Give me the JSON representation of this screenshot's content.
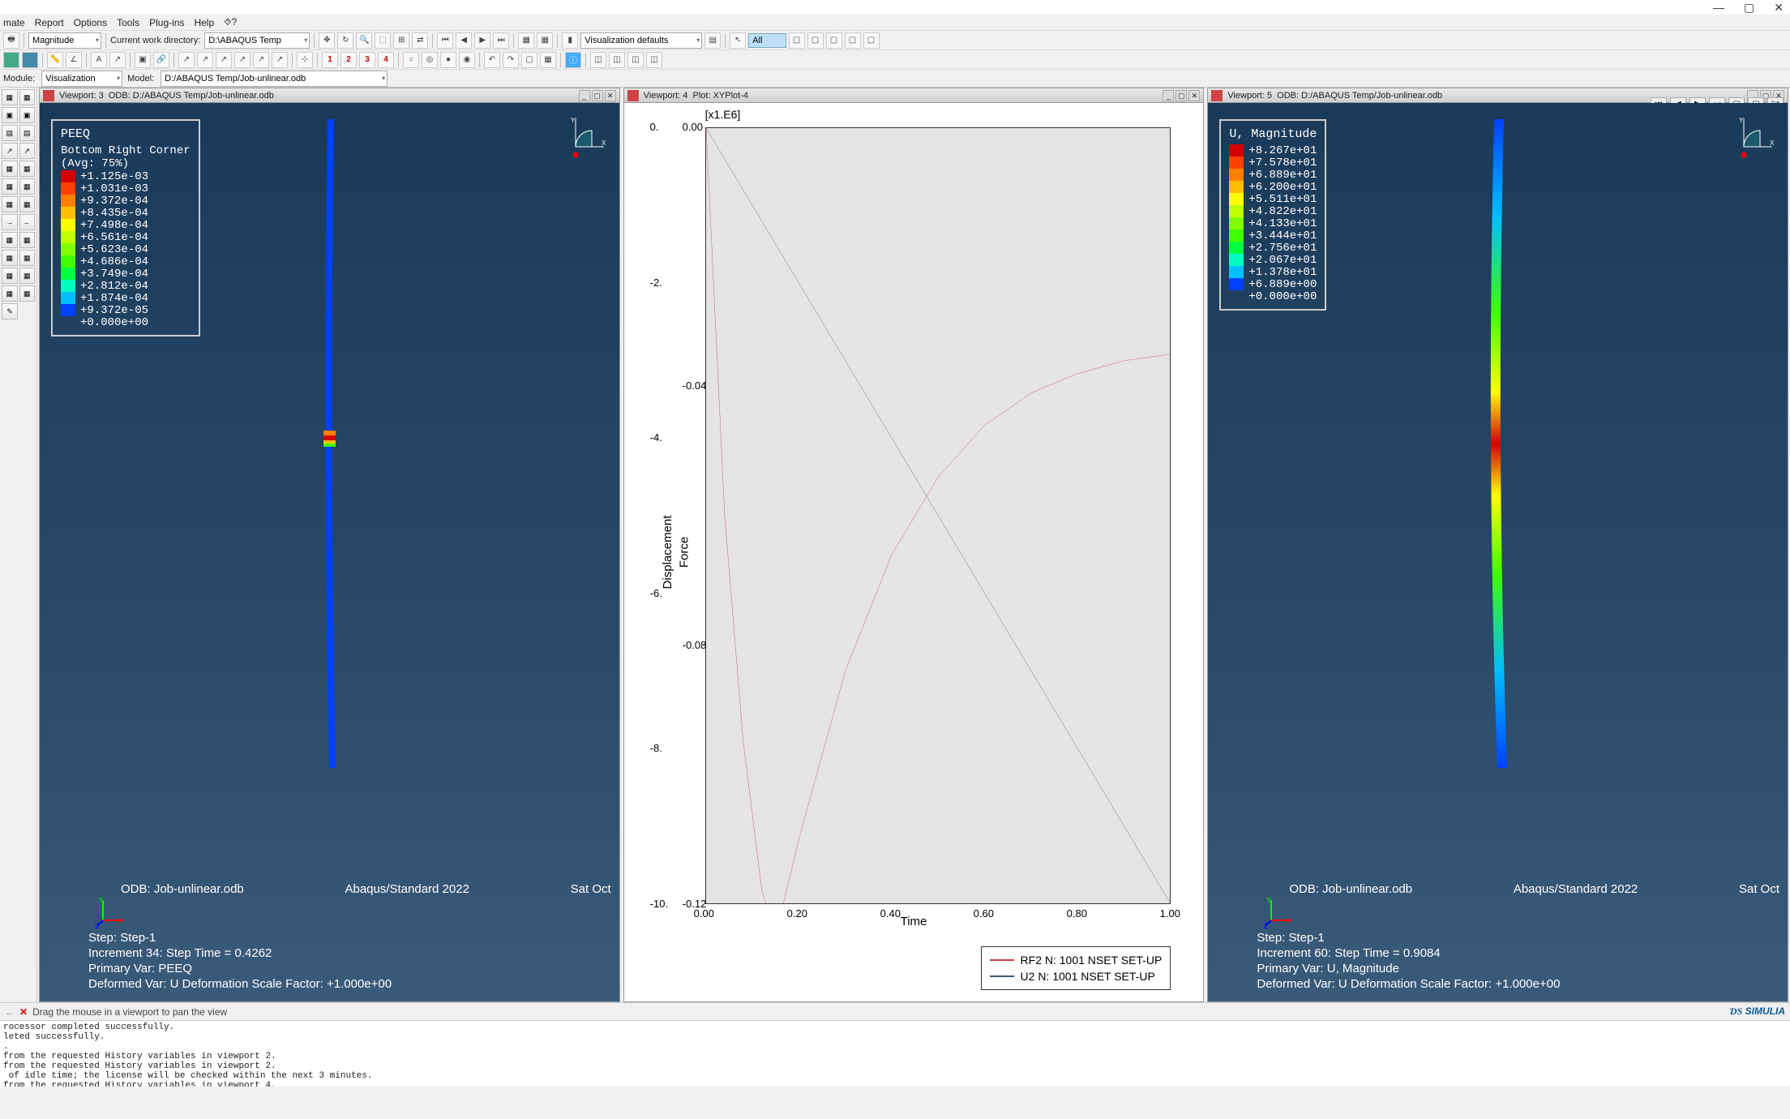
{
  "window": {
    "min": "—",
    "max": "▢",
    "close": "✕"
  },
  "menubar": [
    "mate",
    "Report",
    "Options",
    "Tools",
    "Plug-ins",
    "Help",
    "⯑?"
  ],
  "toolbar1": {
    "combo1": "Magnitude",
    "cwd_label": "Current work directory:",
    "cwd": "D:\\ABAQUS Temp",
    "vizdef": "Visualization defaults",
    "all": "All"
  },
  "toolbar2": {
    "nums": [
      "1",
      "2",
      "3",
      "4"
    ]
  },
  "toolbar3": {
    "module_lbl": "Module:",
    "module": "Visualization",
    "model_lbl": "Model:",
    "model": "D:/ABAQUS Temp/Job-unlinear.odb"
  },
  "playback": [
    "⏮",
    "◀",
    "▶",
    "⏭"
  ],
  "vp3": {
    "hdr_num": "Viewport: 3",
    "hdr_odb": "ODB: D:/ABAQUS Temp/Job-unlinear.odb",
    "legend": {
      "title": "PEEQ",
      "sub1": "Bottom Right Corner",
      "sub2": "(Avg: 75%)",
      "vals": [
        "+1.125e-03",
        "+1.031e-03",
        "+9.372e-04",
        "+8.435e-04",
        "+7.498e-04",
        "+6.561e-04",
        "+5.623e-04",
        "+4.686e-04",
        "+3.749e-04",
        "+2.812e-04",
        "+1.874e-04",
        "+9.372e-05",
        "+0.000e+00"
      ]
    },
    "odb": "ODB: Job-unlinear.odb",
    "brand": "Abaqus/Standard 2022",
    "date": "Sat Oct",
    "step": "Step: Step-1",
    "incr": "Increment     34: Step Time =    0.4262",
    "pvar": "Primary Var: PEEQ",
    "dvar": "Deformed Var: U   Deformation Scale Factor: +1.000e+00"
  },
  "vp4": {
    "hdr_num": "Viewport: 4",
    "hdr_plot": "Plot: XYPlot-4",
    "exponent": "[x1.E6]",
    "ylabel1": "Displacement",
    "ylabel2": "Force",
    "xlabel": "Time",
    "legend1": "RF2 N: 1001 NSET SET-UP",
    "legend2": "U2 N: 1001 NSET SET-UP"
  },
  "vp5": {
    "hdr_num": "Viewport: 5",
    "hdr_odb": "ODB: D:/ABAQUS Temp/Job-unlinear.odb",
    "legend": {
      "title": "U, Magnitude",
      "vals": [
        "+8.267e+01",
        "+7.578e+01",
        "+6.889e+01",
        "+6.200e+01",
        "+5.511e+01",
        "+4.822e+01",
        "+4.133e+01",
        "+3.444e+01",
        "+2.756e+01",
        "+2.067e+01",
        "+1.378e+01",
        "+6.889e+00",
        "+0.000e+00"
      ]
    },
    "odb": "ODB: Job-unlinear.odb",
    "brand": "Abaqus/Standard 2022",
    "date": "Sat Oct",
    "step": "Step: Step-1",
    "incr": "Increment     60: Step Time =    0.9084",
    "pvar": "Primary Var: U, Magnitude",
    "dvar": "Deformed Var: U   Deformation Scale Factor: +1.000e+00"
  },
  "status": {
    "msg": "Drag the mouse in a viewport to pan the view",
    "simulia": "SIMULIA"
  },
  "console": "rocessor completed successfully.\nleted successfully.\n.\nfrom the requested History variables in viewport 2.\nfrom the requested History variables in viewport 2.\n of idle time; the license will be checked within the next 3 minutes.\nfrom the requested History variables in viewport 4.",
  "chart_data": {
    "type": "line",
    "title": "",
    "xlabel": "Time",
    "y1label": "Displacement",
    "y2label": "Force",
    "y2_scale_exponent": "x1.E6",
    "xlim": [
      0.0,
      1.0
    ],
    "y1lim": [
      -10,
      0
    ],
    "y2lim": [
      -0.12,
      0.0
    ],
    "xticks": [
      0.0,
      0.2,
      0.4,
      0.6,
      0.8,
      1.0
    ],
    "y1ticks": [
      0,
      -2,
      -4,
      -6,
      -8,
      -10
    ],
    "y2ticks": [
      0.0,
      -0.04,
      -0.08,
      -0.12
    ],
    "series": [
      {
        "name": "RF2 N: 1001 NSET SET-UP",
        "color": "#d04040",
        "axis": "y2",
        "x": [
          0.0,
          0.04,
          0.08,
          0.12,
          0.15,
          0.2,
          0.3,
          0.4,
          0.5,
          0.6,
          0.7,
          0.8,
          0.9,
          1.0
        ],
        "y": [
          0.0,
          -0.06,
          -0.095,
          -0.118,
          -0.125,
          -0.11,
          -0.084,
          -0.066,
          -0.054,
          -0.046,
          -0.041,
          -0.038,
          -0.036,
          -0.035
        ]
      },
      {
        "name": "U2 N: 1001 NSET SET-UP",
        "color": "#3a5a7a",
        "axis": "y1",
        "x": [
          0.0,
          0.1,
          0.2,
          0.3,
          0.4,
          0.5,
          0.6,
          0.7,
          0.8,
          0.9,
          1.0
        ],
        "y": [
          0.0,
          -1.0,
          -2.0,
          -3.0,
          -4.0,
          -5.0,
          -6.0,
          -7.0,
          -8.0,
          -9.0,
          -10.0
        ]
      }
    ]
  },
  "legend_colors": [
    "#d40000",
    "#ff4000",
    "#ff8000",
    "#ffbf00",
    "#ffff00",
    "#bfff00",
    "#80ff00",
    "#40ff00",
    "#00ff40",
    "#00ffbf",
    "#00bfff",
    "#0040ff"
  ]
}
